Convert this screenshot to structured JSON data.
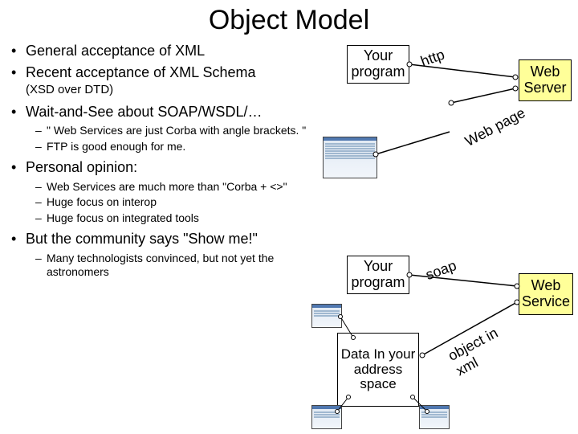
{
  "title": "Object Model",
  "bullets": {
    "b1": "General acceptance of XML",
    "b2": "Recent acceptance of XML Schema",
    "b2_paren": "(XSD over DTD)",
    "b3": "Wait-and-See about SOAP/WSDL/…",
    "b3_sub1": "\" Web Services  are just Corba with angle brackets. \"",
    "b3_sub2": "FTP is good enough for me.",
    "b4": "Personal opinion:",
    "b4_sub1": "Web Services  are much more than \"Corba + <>\"",
    "b4_sub2": "Huge focus on interop",
    "b4_sub3": "Huge focus on integrated tools",
    "b5": "But the community says \"Show me!\"",
    "b5_sub1": "Many technologists convinced, but not yet the astronomers"
  },
  "diagram": {
    "your_program_top": "Your program",
    "web_server": "Web Server",
    "http": "http",
    "web_page": "Web page",
    "your_program_bot": "Your program",
    "data_box": "Data In your address space",
    "web_service": "Web Service",
    "soap": "soap",
    "object_in_xml": "object in xml"
  }
}
